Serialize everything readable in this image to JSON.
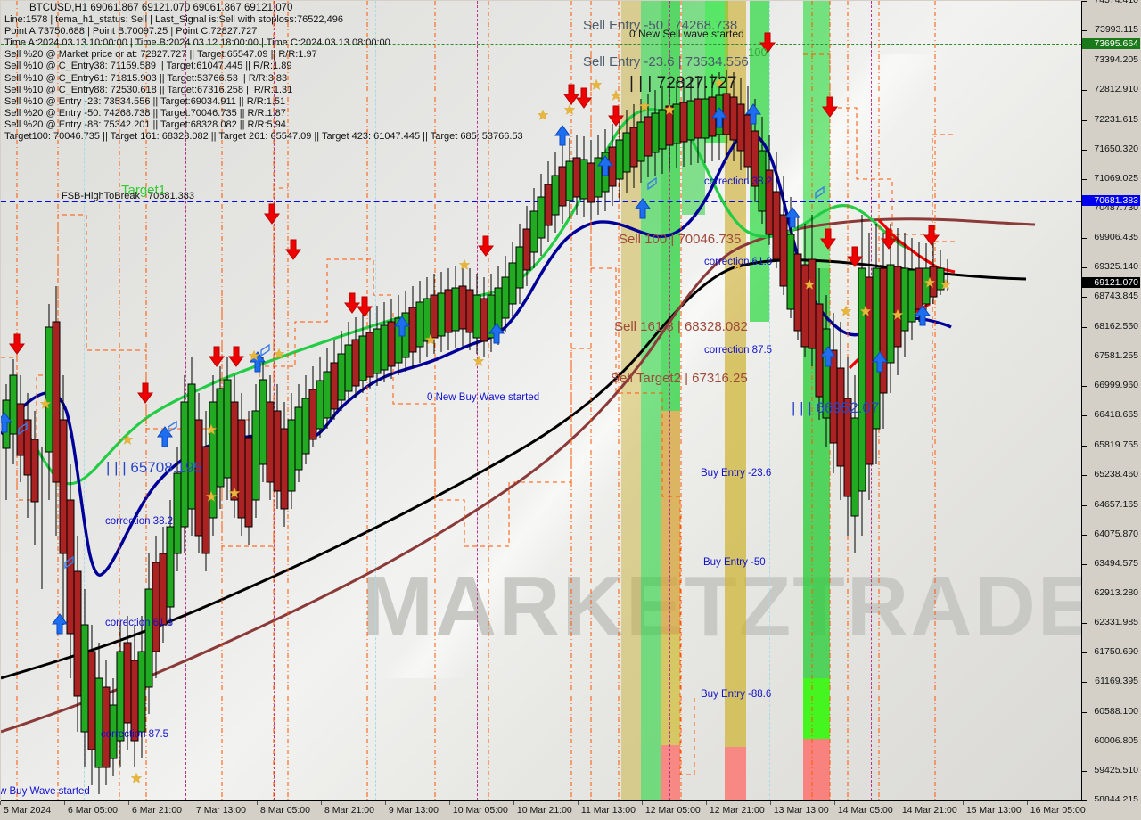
{
  "symbol_header": {
    "title": "BTCUSD,H1  69061.867 69121.070 69061.867 69121.070",
    "line1": "Line:1578 | tema_h1_status: Sell | Last_Signal is:Sell with stoploss:76522,496",
    "line2": "Point A:73750.688 | Point B:70097.25 | Point C:72827.727",
    "line3": "Time A:2024.03.13 10:00:00 | Time B:2024.03.12 18:00:00 | Time C:2024.03.13 08:00:00",
    "line4": "Sell %20 @ Market price or at: 72827.727 || Target:65547.09 || R/R:1.97",
    "line5": "Sell %10 @ C_Entry38: 71159.589 || Target:61047.445 || R/R:1.89",
    "line6": "Sell %10 @ C_Entry61: 71815.903 || Target:53766.53 || R/R:3.83",
    "line7": "Sell %10 @ C_Entry88: 72530.618 || Target:67316.258 || R/R:1.31",
    "line8": "Sell %10 @ Entry -23: 73534.556 || Target:69034.911 || R/R:1.51",
    "line9": "Sell %20 @ Entry -50: 74268.738 || Target:70046.735 || R/R:1.87",
    "line10": "Sell %20 @ Entry -88: 75342.201 || Target:68328.082 || R/R:5.94",
    "line11": "Target100: 70046.735 || Target 161: 68328.082 || Target 261: 65547.09 || Target 423: 61047.445 || Target 685: 53766.53"
  },
  "watermark": {
    "text": "MARKETZTRADE"
  },
  "chart_data": {
    "type": "line",
    "title": "BTCUSD,H1",
    "symbol": "BTCUSD",
    "timeframe": "H1",
    "ohlc_last": {
      "open": 69061.867,
      "high": 69121.07,
      "low": 69061.867,
      "close": 69121.07
    },
    "ylim": [
      58844.215,
      74574.41
    ],
    "ylabel": "",
    "xlabel": "",
    "grid": true,
    "legend": "none",
    "y_ticks": [
      74574.41,
      73993.115,
      73394.205,
      72812.91,
      72231.615,
      71650.32,
      71069.025,
      70487.73,
      69906.435,
      69325.14,
      68743.845,
      68162.55,
      67581.255,
      66999.96,
      66418.665,
      65819.755,
      65238.46,
      64657.165,
      64075.87,
      63494.575,
      62913.28,
      62331.985,
      61750.69,
      61169.395,
      60588.1,
      60006.805,
      59425.51,
      58844.215
    ],
    "y_tick_labels": [
      "74574.410",
      "73993.115",
      "73394.205",
      "72812.910",
      "72231.615",
      "71650.320",
      "71069.025",
      "70487.730",
      "69906.435",
      "69325.140",
      "68743.845",
      "68162.550",
      "67581.255",
      "66999.960",
      "66418.665",
      "65819.755",
      "65238.460",
      "64657.165",
      "64075.870",
      "63494.575",
      "62913.280",
      "62331.985",
      "61750.690",
      "61169.395",
      "60588.100",
      "60006.805",
      "59425.510",
      "58844.215"
    ],
    "price_tags": [
      {
        "value": "73695.664",
        "bg": "#1a7a1a",
        "fg": "#ffffff",
        "line": "#1a7a1a",
        "style": "dashed"
      },
      {
        "value": "70681.383",
        "bg": "#0000ee",
        "fg": "#ffffff",
        "line": "#0000ee",
        "style": "solid"
      },
      {
        "value": "69121.070",
        "bg": "#000000",
        "fg": "#ffffff",
        "line": "#6a7a8a",
        "style": "solid"
      }
    ],
    "x_tick_labels": [
      "5 Mar 2024",
      "6 Mar 05:00",
      "6 Mar 21:00",
      "7 Mar 13:00",
      "8 Mar 05:00",
      "8 Mar 21:00",
      "9 Mar 13:00",
      "10 Mar 05:00",
      "10 Mar 21:00",
      "11 Mar 13:00",
      "12 Mar 05:00",
      "12 Mar 21:00",
      "13 Mar 13:00",
      "14 Mar 05:00",
      "14 Mar 21:00",
      "15 Mar 13:00",
      "16 Mar 05:00"
    ],
    "series": [
      {
        "name": "fast-ma-blue",
        "color": "#000099",
        "values": []
      },
      {
        "name": "mid-ma-green",
        "color": "#22cc44",
        "values": []
      },
      {
        "name": "slow-ma-brown",
        "color": "#993333",
        "values": []
      },
      {
        "name": "slow-ma-black",
        "color": "#000000",
        "values": []
      },
      {
        "name": "signal-red",
        "color": "#ee0000",
        "values": []
      }
    ]
  },
  "annotations": {
    "target1": {
      "text": "Target1",
      "color": "#33cc33"
    },
    "fsb": {
      "text": "FSB-HighToBreak | 70681.383",
      "color": "#101010"
    },
    "sell_entry_50": {
      "text": "Sell Entry -50 | 74268.738",
      "color": "#4a5a6a"
    },
    "new_sell_wave": {
      "text": "0 New Sell wave started",
      "color": "#1a1a1a"
    },
    "sell_entry_236": {
      "text": "Sell Entry -23.6 | 73534.556",
      "color": "#4a5a6a"
    },
    "point_c": {
      "text": "| | | 72827.727",
      "color": "#1a1a1a"
    },
    "level_100": {
      "text": "100",
      "color": "#33aa33"
    },
    "sell_100": {
      "text": "Sell 100 | 70046.735",
      "color": "#9e4a3a"
    },
    "sell_1618": {
      "text": "Sell 161.8 | 68328.082",
      "color": "#9e4a3a"
    },
    "sell_target2": {
      "text": "Sell Target2 | 67316.25",
      "color": "#9e4a3a"
    },
    "corr_382_r": {
      "text": "correction 38.2",
      "color": "#1111cc"
    },
    "corr_618_r": {
      "text": "correction 61.8",
      "color": "#1111cc"
    },
    "corr_875_r": {
      "text": "correction 87.5",
      "color": "#1111cc"
    },
    "corr_382_l": {
      "text": "correction 38.2",
      "color": "#1111cc"
    },
    "corr_618_l": {
      "text": "correction 61.8",
      "color": "#1111cc"
    },
    "corr_875_l": {
      "text": "correction 87.5",
      "color": "#1111cc"
    },
    "low_level": {
      "text": "| | | 65708.195",
      "color": "#2a46c8"
    },
    "low_level2": {
      "text": "| | | 66952.07",
      "color": "#2a46c8"
    },
    "new_buy_wave": {
      "text": "0 New Buy Wave started",
      "color": "#1111cc"
    },
    "new_buy_wave_l": {
      "text": "w Buy Wave started",
      "color": "#1111cc"
    },
    "buy_entry_236": {
      "text": "Buy Entry -23.6",
      "color": "#1111cc"
    },
    "buy_entry_50": {
      "text": "Buy Entry -50",
      "color": "#1111cc"
    },
    "buy_entry_886": {
      "text": "Buy Entry -88.6",
      "color": "#1111cc"
    }
  }
}
